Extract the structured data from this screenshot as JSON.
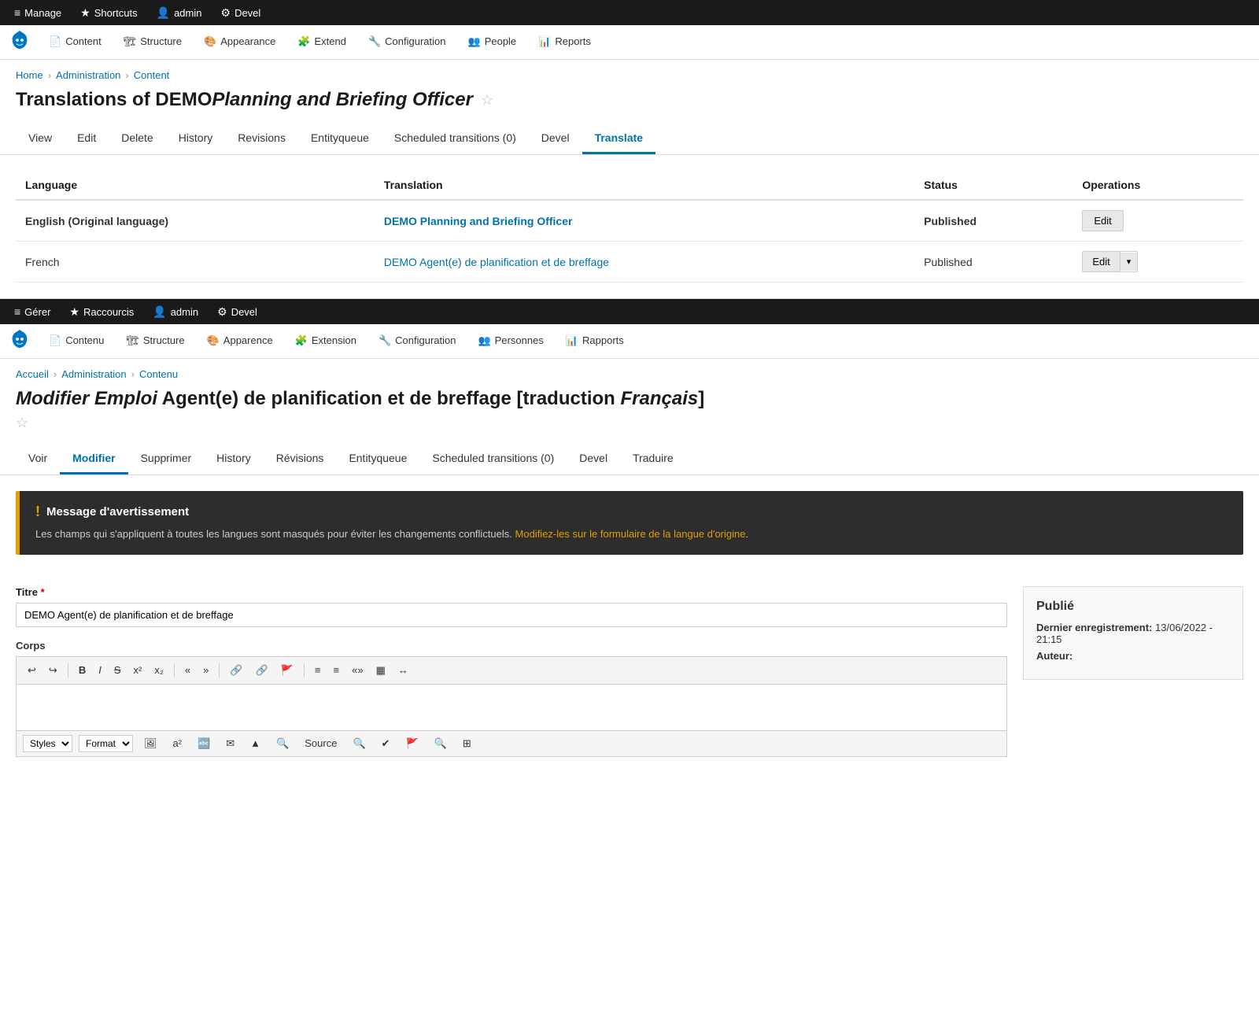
{
  "top_section": {
    "admin_bar": {
      "items": [
        {
          "id": "manage",
          "label": "Manage",
          "icon": "≡"
        },
        {
          "id": "shortcuts",
          "label": "Shortcuts",
          "icon": "★"
        },
        {
          "id": "admin",
          "label": "admin",
          "icon": "👤"
        },
        {
          "id": "devel",
          "label": "Devel",
          "icon": "⚙"
        }
      ]
    },
    "nav": {
      "items": [
        {
          "id": "content",
          "label": "Content",
          "icon": "📄"
        },
        {
          "id": "structure",
          "label": "Structure",
          "icon": "🏗"
        },
        {
          "id": "appearance",
          "label": "Appearance",
          "icon": "🎨"
        },
        {
          "id": "extend",
          "label": "Extend",
          "icon": "🧩"
        },
        {
          "id": "configuration",
          "label": "Configuration",
          "icon": "🔧"
        },
        {
          "id": "people",
          "label": "People",
          "icon": "👥"
        },
        {
          "id": "reports",
          "label": "Reports",
          "icon": "📊"
        }
      ]
    },
    "breadcrumb": [
      "Home",
      "Administration",
      "Content"
    ],
    "page_title": "Translations of DEMOPlanning and Briefing Officer",
    "page_title_em": "Planning and Briefing Officer",
    "tabs": [
      {
        "id": "view",
        "label": "View"
      },
      {
        "id": "edit",
        "label": "Edit"
      },
      {
        "id": "delete",
        "label": "Delete"
      },
      {
        "id": "history",
        "label": "History"
      },
      {
        "id": "revisions",
        "label": "Revisions"
      },
      {
        "id": "entityqueue",
        "label": "Entityqueue"
      },
      {
        "id": "scheduled",
        "label": "Scheduled transitions (0)"
      },
      {
        "id": "devel",
        "label": "Devel"
      },
      {
        "id": "translate",
        "label": "Translate",
        "active": true
      }
    ],
    "table": {
      "headers": [
        "Language",
        "Translation",
        "Status",
        "Operations"
      ],
      "rows": [
        {
          "language": "English (Original language)",
          "bold": true,
          "translation_label": "DEMO Planning and Briefing Officer",
          "translation_href": "#",
          "status": "Published",
          "op_type": "single",
          "op_label": "Edit"
        },
        {
          "language": "French",
          "bold": false,
          "translation_label": "DEMO Agent(e) de planification et de breffage",
          "translation_href": "#",
          "status": "Published",
          "op_type": "split",
          "op_label": "Edit"
        }
      ]
    }
  },
  "second_section": {
    "admin_bar": {
      "items": [
        {
          "id": "gerer",
          "label": "Gérer",
          "icon": "≡"
        },
        {
          "id": "raccourcis",
          "label": "Raccourcis",
          "icon": "★"
        },
        {
          "id": "admin",
          "label": "admin",
          "icon": "👤"
        },
        {
          "id": "devel",
          "label": "Devel",
          "icon": "⚙"
        }
      ]
    },
    "nav": {
      "items": [
        {
          "id": "contenu",
          "label": "Contenu",
          "icon": "📄"
        },
        {
          "id": "structure",
          "label": "Structure",
          "icon": "🏗"
        },
        {
          "id": "apparence",
          "label": "Apparence",
          "icon": "🎨"
        },
        {
          "id": "extension",
          "label": "Extension",
          "icon": "🧩"
        },
        {
          "id": "configuration",
          "label": "Configuration",
          "icon": "🔧"
        },
        {
          "id": "personnes",
          "label": "Personnes",
          "icon": "👥"
        },
        {
          "id": "rapports",
          "label": "Rapports",
          "icon": "📊"
        }
      ]
    },
    "breadcrumb": [
      "Accueil",
      "Administration",
      "Contenu"
    ],
    "page_title_prefix": "Modifier Emploi",
    "page_title_em": "Modifier Emploi",
    "page_title": "Agent(e) de planification et de breffage [traduction Français]",
    "tabs": [
      {
        "id": "voir",
        "label": "Voir"
      },
      {
        "id": "modifier",
        "label": "Modifier",
        "active": true
      },
      {
        "id": "supprimer",
        "label": "Supprimer"
      },
      {
        "id": "history",
        "label": "History"
      },
      {
        "id": "revisions",
        "label": "Révisions"
      },
      {
        "id": "entityqueue",
        "label": "Entityqueue"
      },
      {
        "id": "scheduled",
        "label": "Scheduled transitions (0)"
      },
      {
        "id": "devel",
        "label": "Devel"
      },
      {
        "id": "traduire",
        "label": "Traduire"
      }
    ],
    "warning": {
      "title": "Message d'avertissement",
      "body": "Les champs qui s'appliquent à toutes les langues sont masqués pour éviter les changements conflictuels.",
      "link_label": "Modifiez-les sur le formulaire de la langue d'origine",
      "link_href": "#"
    },
    "form": {
      "title_label": "Titre",
      "title_required": true,
      "title_value": "DEMO Agent(e) de planification et de breffage",
      "body_label": "Corps",
      "toolbar_buttons": [
        "↩",
        "↪",
        "B",
        "I",
        "S",
        "x²",
        "x₂",
        "|",
        "«",
        "»",
        "|",
        "🔗",
        "🔗",
        "🚩",
        "≡",
        "≡",
        "«",
        "»",
        "▦",
        "↔"
      ],
      "footer_items": [
        "Styles",
        "Format"
      ]
    },
    "sidebar": {
      "published_title": "Publié",
      "last_saved_label": "Dernier enregistrement:",
      "last_saved_value": "13/06/2022 - 21:15",
      "author_label": "Auteur:"
    }
  }
}
